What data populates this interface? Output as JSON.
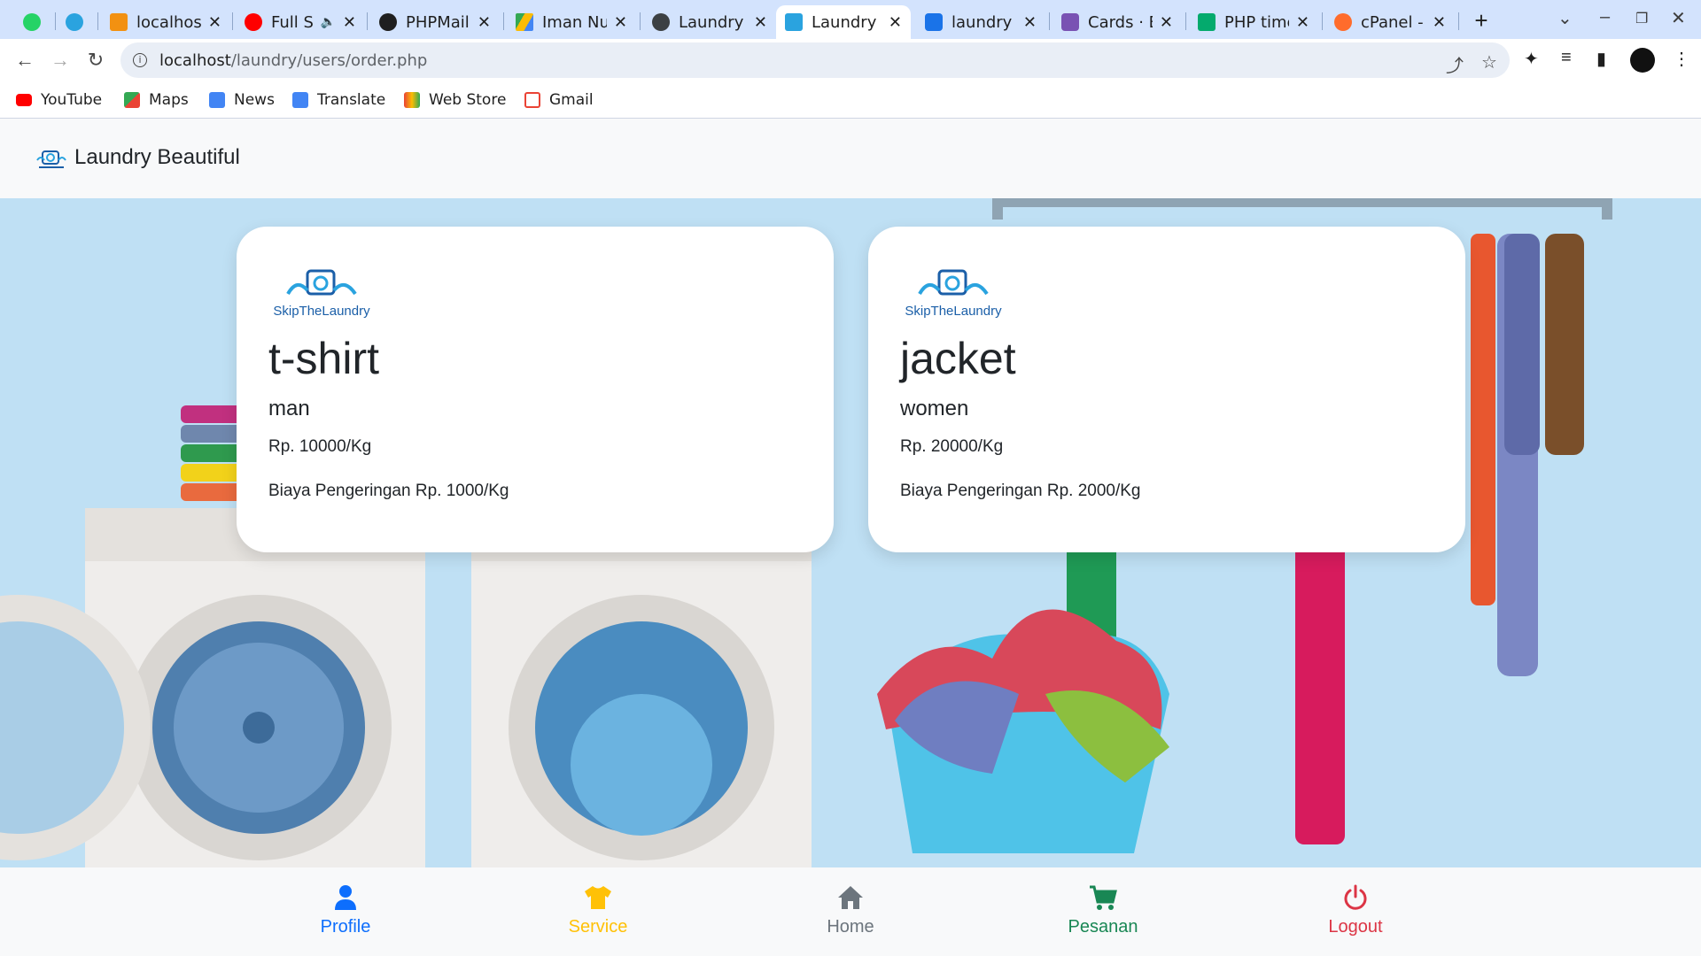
{
  "browser": {
    "tabs": [
      {
        "title": "",
        "favicon": "whatsapp-icon",
        "color": "#25d366",
        "pinned": true
      },
      {
        "title": "",
        "favicon": "telegram-icon",
        "color": "#2aa3df",
        "pinned": true
      },
      {
        "title": "localhost",
        "favicon": "phpmyadmin-icon",
        "color": "#f29111"
      },
      {
        "title": "Full S",
        "favicon": "youtube-icon",
        "color": "#ff0000",
        "audio": true
      },
      {
        "title": "PHPMail",
        "favicon": "github-icon",
        "color": "#1f1f1f"
      },
      {
        "title": "Iman Nu",
        "favicon": "google-drive-icon",
        "color": "#fbbc04"
      },
      {
        "title": "Laundry",
        "favicon": "globe-icon",
        "color": "#3c4043"
      },
      {
        "title": "Laundry",
        "favicon": "laundry-icon",
        "color": "#2aa3df",
        "active": true
      },
      {
        "title": "laundry",
        "favicon": "share-icon",
        "color": "#1a73e8"
      },
      {
        "title": "Cards · B",
        "favicon": "bootstrap-icon",
        "color": "#7952b3"
      },
      {
        "title": "PHP time",
        "favicon": "w3schools-icon",
        "color": "#04aa6d"
      },
      {
        "title": "cPanel -",
        "favicon": "cpanel-icon",
        "color": "#ff6c2c"
      }
    ],
    "url_host": "localhost",
    "url_path": "/laundry/users/order.php",
    "bookmarks": [
      {
        "label": "YouTube",
        "icon": "youtube-icon",
        "color": "#ff0000"
      },
      {
        "label": "Maps",
        "icon": "maps-icon",
        "color": "#34a853"
      },
      {
        "label": "News",
        "icon": "news-icon",
        "color": "#4285f4"
      },
      {
        "label": "Translate",
        "icon": "translate-icon",
        "color": "#4285f4"
      },
      {
        "label": "Web Store",
        "icon": "web-store-icon",
        "color": "#ea4335"
      },
      {
        "label": "Gmail",
        "icon": "gmail-icon",
        "color": "#ea4335"
      }
    ]
  },
  "app": {
    "brand": "Laundry Beautiful",
    "cards": [
      {
        "name": "t-shirt",
        "gender": "man",
        "price": "Rp. 10000/Kg",
        "drying": "Biaya Pengeringan Rp. 1000/Kg",
        "logo_text": "SkipTheLaundry"
      },
      {
        "name": "jacket",
        "gender": "women",
        "price": "Rp. 20000/Kg",
        "drying": "Biaya Pengeringan Rp. 2000/Kg",
        "logo_text": "SkipTheLaundry"
      }
    ],
    "bottom_nav": [
      {
        "label": "Profile",
        "icon": "person-icon",
        "color": "#0d6efd"
      },
      {
        "label": "Service",
        "icon": "tshirt-icon",
        "color": "#ffc107"
      },
      {
        "label": "Home",
        "icon": "home-icon",
        "color": "#6c757d"
      },
      {
        "label": "Pesanan",
        "icon": "cart-icon",
        "color": "#198754"
      },
      {
        "label": "Logout",
        "icon": "power-icon",
        "color": "#dc3545"
      }
    ]
  }
}
